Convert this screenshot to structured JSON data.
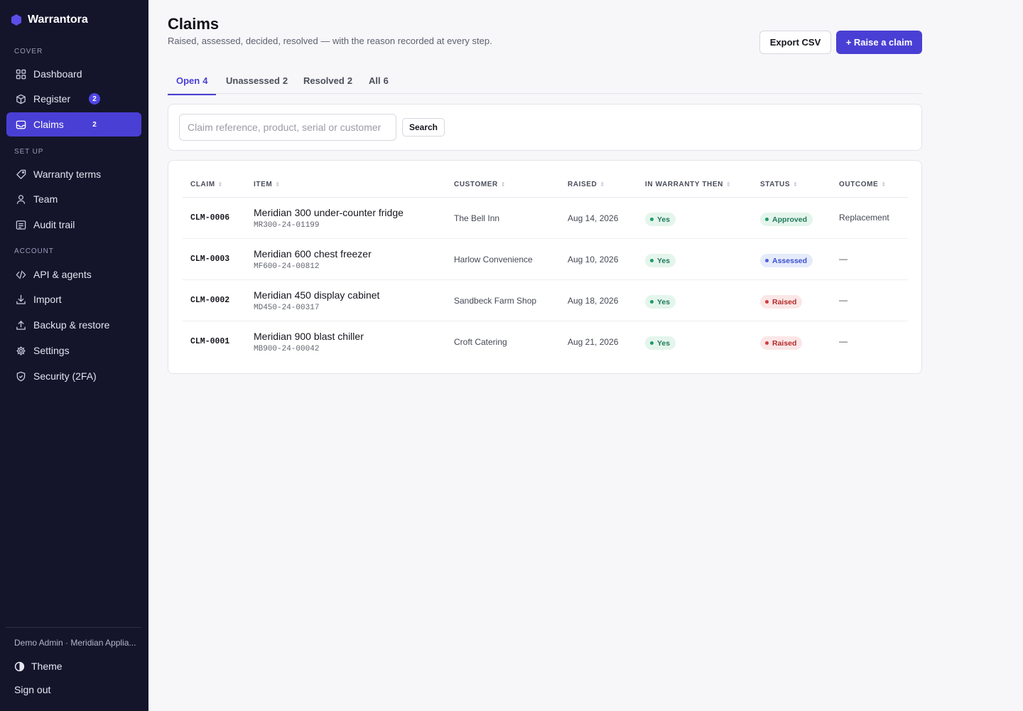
{
  "app": {
    "name": "Warrantora"
  },
  "colors": {
    "accent": "#4a3fd4",
    "sidebar_bg": "#14152b",
    "success": "#1f7a58",
    "info": "#3b4fd0",
    "danger": "#b42b2b"
  },
  "sidebar": {
    "sections": {
      "cover": "COVER",
      "setup": "SET UP",
      "account": "ACCOUNT"
    },
    "items": [
      {
        "label": "Dashboard",
        "icon": "grid-icon"
      },
      {
        "label": "Register",
        "icon": "box-icon",
        "badge": "2"
      },
      {
        "label": "Claims",
        "icon": "inbox-icon",
        "badge": "2",
        "active": true
      },
      {
        "label": "Warranty terms",
        "icon": "tag-icon"
      },
      {
        "label": "Team",
        "icon": "user-icon"
      },
      {
        "label": "Audit trail",
        "icon": "list-icon"
      },
      {
        "label": "API & agents",
        "icon": "code-icon"
      },
      {
        "label": "Import",
        "icon": "download-icon"
      },
      {
        "label": "Backup & restore",
        "icon": "upload-icon"
      },
      {
        "label": "Settings",
        "icon": "gear-icon"
      },
      {
        "label": "Security (2FA)",
        "icon": "shield-icon"
      }
    ],
    "footer": {
      "user": "Demo Admin · Meridian Applia...",
      "theme": "Theme",
      "sign_out": "Sign out"
    }
  },
  "header": {
    "title": "Claims",
    "subtitle": "Raised, assessed, decided, resolved — with the reason recorded at every step.",
    "export_label": "Export CSV",
    "raise_label": "+ Raise a claim"
  },
  "tabs": [
    {
      "label": "Open",
      "count": "4",
      "active": true
    },
    {
      "label": "Unassessed",
      "count": "2"
    },
    {
      "label": "Resolved",
      "count": "2"
    },
    {
      "label": "All",
      "count": "6"
    }
  ],
  "search": {
    "placeholder": "Claim reference, product, serial or customer",
    "value": "",
    "button": "Search"
  },
  "table": {
    "columns": [
      "CLAIM",
      "ITEM",
      "CUSTOMER",
      "RAISED",
      "IN WARRANTY THEN",
      "STATUS",
      "OUTCOME"
    ],
    "rows": [
      {
        "claim": "CLM-0006",
        "item": "Meridian 300 under-counter fridge",
        "serial": "MR300-24-01199",
        "customer": "The Bell Inn",
        "raised": "Aug 14, 2026",
        "warranty": "Yes",
        "status": "Approved",
        "outcome": "Replacement"
      },
      {
        "claim": "CLM-0003",
        "item": "Meridian 600 chest freezer",
        "serial": "MF600-24-00812",
        "customer": "Harlow Convenience",
        "raised": "Aug 10, 2026",
        "warranty": "Yes",
        "status": "Assessed",
        "outcome": "—"
      },
      {
        "claim": "CLM-0002",
        "item": "Meridian 450 display cabinet",
        "serial": "MD450-24-00317",
        "customer": "Sandbeck Farm Shop",
        "raised": "Aug 18, 2026",
        "warranty": "Yes",
        "status": "Raised",
        "outcome": "—"
      },
      {
        "claim": "CLM-0001",
        "item": "Meridian 900 blast chiller",
        "serial": "MB900-24-00042",
        "customer": "Croft Catering",
        "raised": "Aug 21, 2026",
        "warranty": "Yes",
        "status": "Raised",
        "outcome": "—"
      }
    ]
  }
}
